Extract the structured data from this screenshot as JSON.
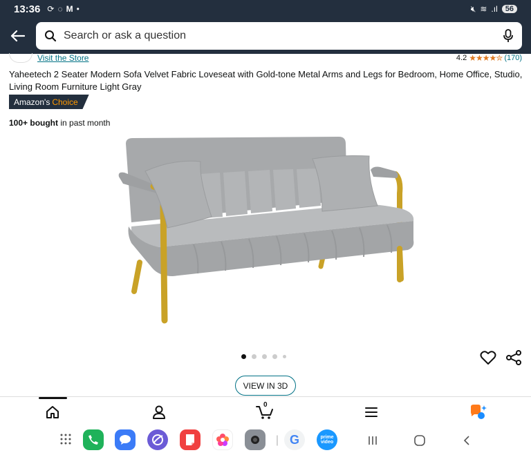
{
  "status_bar": {
    "time": "13:36",
    "battery": "56"
  },
  "search": {
    "placeholder": "Search or ask a question"
  },
  "store": {
    "link": "Visit the Store"
  },
  "rating": {
    "value": "4.2",
    "stars": "★★★★✮",
    "count": "(170)"
  },
  "product": {
    "title": "Yaheetech 2 Seater Modern Sofa Velvet Fabric Loveseat with Gold-tone Metal Arms and Legs for Bedroom, Home Office, Studio, Living Room Furniture Light Gray",
    "badge_prefix": "Amazon's",
    "badge_choice": "Choice",
    "bought_bold": "100+ bought",
    "bought_rest": " in past month",
    "view3d": "VIEW IN 3D",
    "image_index": 1,
    "image_count": 5
  },
  "colors": {
    "header": "#232f3e",
    "link": "#007185",
    "star": "#de7921",
    "choice": "#ff9900"
  },
  "bottom_nav": [
    "home-icon",
    "profile-icon",
    "cart-icon",
    "menu-icon",
    "rufus-icon"
  ],
  "cart_count": "0",
  "dock": {
    "apps": [
      "apps-grid-icon",
      "phone-icon",
      "messages-icon",
      "internet-icon",
      "notes-icon",
      "gallery-icon",
      "camera-icon",
      "google-icon",
      "prime-video-icon"
    ],
    "prime_label": "prime video"
  }
}
